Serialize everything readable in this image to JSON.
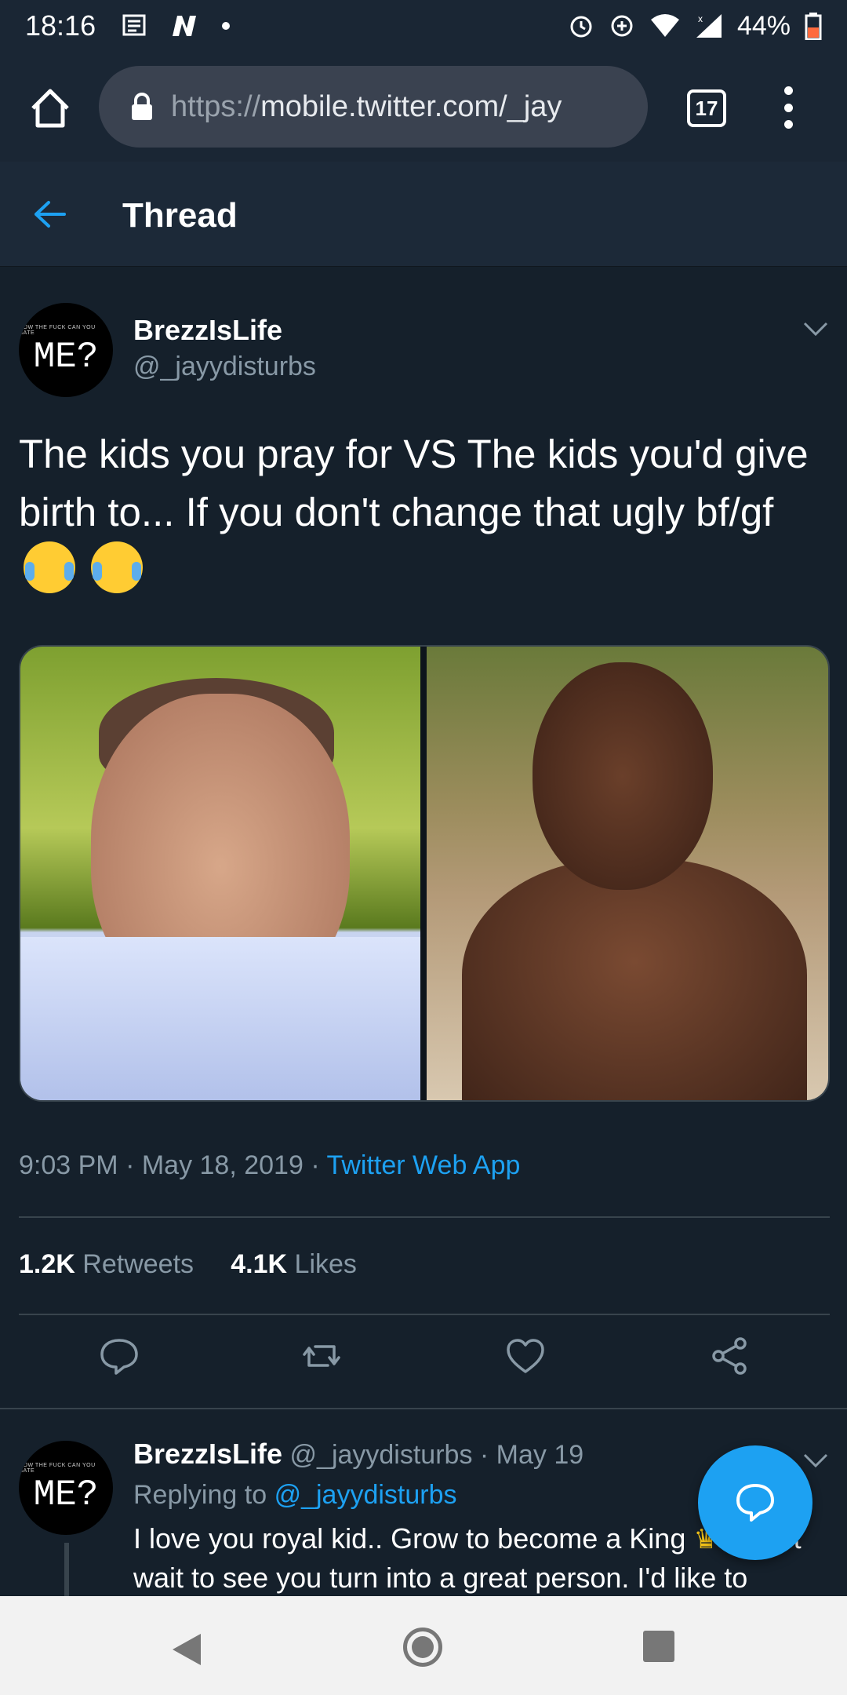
{
  "status_bar": {
    "time": "18:16",
    "battery": "44%",
    "left_icons": [
      "news-icon",
      "n-app-icon",
      "dot-icon"
    ],
    "right_icons": [
      "alarm-icon",
      "data-saver-icon",
      "wifi-icon",
      "signal-icon",
      "battery-icon"
    ]
  },
  "browser": {
    "url_scheme": "https://",
    "url_host": "mobile.twitter.com/_jay",
    "tab_count": "17"
  },
  "header": {
    "title": "Thread"
  },
  "tweet": {
    "author_name": "BrezzIsLife",
    "author_handle": "@_jayydisturbs",
    "avatar_small_text": "HOW THE FUCK CAN YOU HATE",
    "avatar_big_text": "ME?",
    "text": "The kids you pray for  VS The kids you'd give birth to... If you don't change that ugly bf/gf",
    "time": "9:03 PM",
    "date": "May 18, 2019",
    "source": "Twitter Web App",
    "retweets_count": "1.2K",
    "retweets_label": "Retweets",
    "likes_count": "4.1K",
    "likes_label": "Likes"
  },
  "reply": {
    "author_name": "BrezzIsLife",
    "author_handle": "@_jayydisturbs",
    "date": "May 19",
    "replying_label": "Replying to",
    "replying_to": "@_jayydisturbs",
    "avatar_small_text": "HOW THE FUCK CAN YOU HATE",
    "avatar_big_text": "ME?",
    "text_part1": "I love you royal kid.. Grow to become a King",
    "text_part2": "I can't wait to see you turn into a great person. I'd like to"
  },
  "colors": {
    "background": "#15202b",
    "accent": "#1da1f2",
    "muted_text": "#8899a6"
  }
}
